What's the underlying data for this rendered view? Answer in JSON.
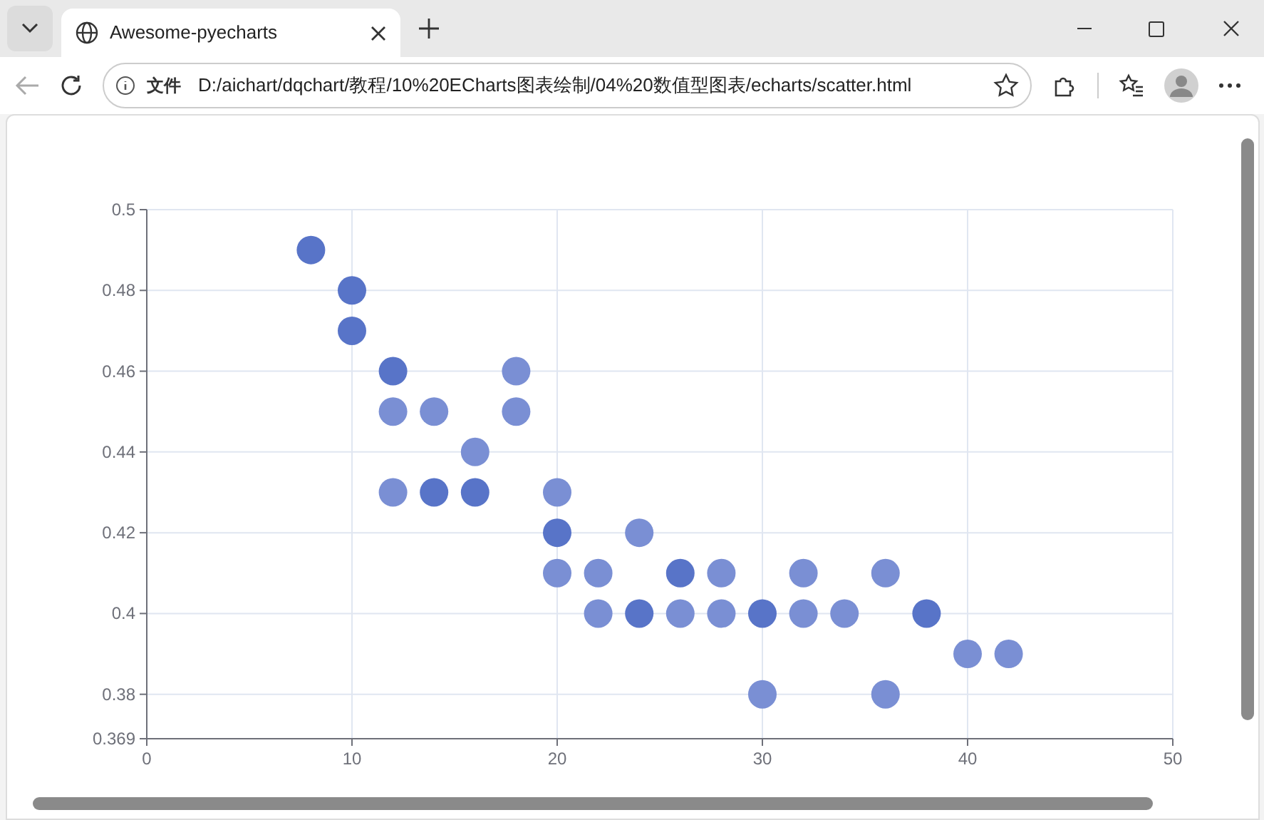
{
  "browser": {
    "tab_title": "Awesome-pyecharts",
    "address_label": "文件",
    "url": "D:/aichart/dqchart/教程/10%20ECharts图表绘制/04%20数值型图表/echarts/scatter.html"
  },
  "chart": {
    "chart_data": {
      "type": "scatter",
      "x": [
        8,
        10,
        10,
        12,
        12,
        14,
        12,
        14,
        16,
        16,
        18,
        18,
        20,
        20,
        20,
        22,
        22,
        24,
        24,
        26,
        26,
        28,
        28,
        30,
        30,
        32,
        32,
        34,
        36,
        36,
        38,
        40,
        42
      ],
      "grid": true,
      "series": [
        {
          "color": "#7a8fd4",
          "values": [
            null,
            null,
            null,
            null,
            0.45,
            0.45,
            0.43,
            null,
            0.44,
            null,
            0.46,
            0.45,
            0.43,
            null,
            0.41,
            0.41,
            0.4,
            0.42,
            null,
            null,
            0.4,
            0.41,
            0.4,
            null,
            0.38,
            0.41,
            0.4,
            0.4,
            0.41,
            0.38,
            null,
            0.39,
            0.39
          ]
        },
        {
          "color": "#5874c8",
          "values": [
            0.49,
            0.48,
            0.47,
            0.46,
            null,
            null,
            null,
            0.43,
            null,
            0.43,
            null,
            null,
            null,
            0.42,
            null,
            null,
            null,
            null,
            0.4,
            0.41,
            null,
            null,
            null,
            0.4,
            null,
            null,
            null,
            null,
            null,
            null,
            0.4,
            null,
            null
          ]
        }
      ],
      "xlim": [
        0,
        50
      ],
      "ylim": [
        0.369,
        0.5
      ],
      "xticks": [
        0,
        10,
        20,
        30,
        40,
        50
      ],
      "yticks": [
        {
          "value": 0.369,
          "label": "0.369"
        },
        {
          "value": 0.38,
          "label": "0.38"
        },
        {
          "value": 0.4,
          "label": "0.4"
        },
        {
          "value": 0.42,
          "label": "0.42"
        },
        {
          "value": 0.44,
          "label": "0.44"
        },
        {
          "value": 0.46,
          "label": "0.46"
        },
        {
          "value": 0.48,
          "label": "0.48"
        },
        {
          "value": 0.5,
          "label": "0.5"
        }
      ]
    }
  }
}
